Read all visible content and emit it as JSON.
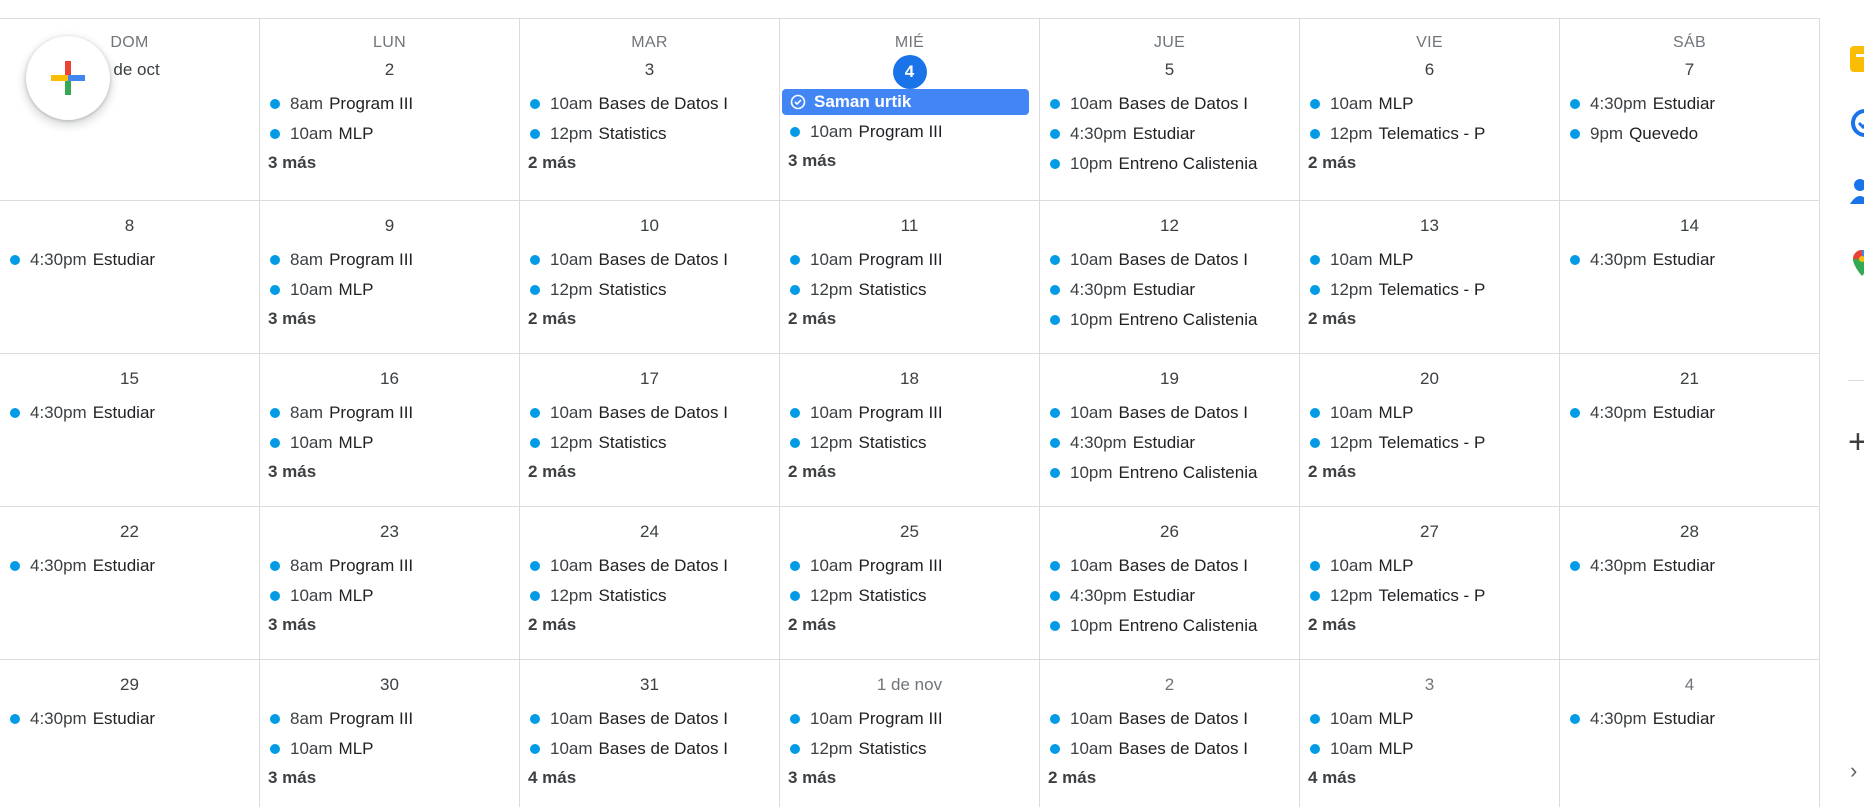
{
  "weekdays": [
    "DOM",
    "LUN",
    "MAR",
    "MIÉ",
    "JUE",
    "VIE",
    "SÁB"
  ],
  "weeks": [
    [
      {
        "day": "1 de oct",
        "events": [],
        "more": ""
      },
      {
        "day": "2",
        "events": [
          {
            "time": "8am",
            "title": "Program III"
          },
          {
            "time": "10am",
            "title": "MLP"
          }
        ],
        "more": "3 más"
      },
      {
        "day": "3",
        "events": [
          {
            "time": "10am",
            "title": "Bases de Datos I"
          },
          {
            "time": "12pm",
            "title": "Statistics"
          }
        ],
        "more": "2 más"
      },
      {
        "day": "4",
        "today": true,
        "chip": "Saman urtik",
        "events": [
          {
            "time": "10am",
            "title": "Program III"
          }
        ],
        "more": "3 más"
      },
      {
        "day": "5",
        "events": [
          {
            "time": "10am",
            "title": "Bases de Datos I"
          },
          {
            "time": "4:30pm",
            "title": "Estudiar"
          },
          {
            "time": "10pm",
            "title": "Entreno Calistenia"
          }
        ],
        "more": ""
      },
      {
        "day": "6",
        "events": [
          {
            "time": "10am",
            "title": "MLP"
          },
          {
            "time": "12pm",
            "title": "Telematics - P"
          }
        ],
        "more": "2 más"
      },
      {
        "day": "7",
        "events": [
          {
            "time": "4:30pm",
            "title": "Estudiar"
          },
          {
            "time": "9pm",
            "title": "Quevedo"
          }
        ],
        "more": ""
      }
    ],
    [
      {
        "day": "8",
        "events": [
          {
            "time": "4:30pm",
            "title": "Estudiar"
          }
        ],
        "more": ""
      },
      {
        "day": "9",
        "events": [
          {
            "time": "8am",
            "title": "Program III"
          },
          {
            "time": "10am",
            "title": "MLP"
          }
        ],
        "more": "3 más"
      },
      {
        "day": "10",
        "events": [
          {
            "time": "10am",
            "title": "Bases de Datos I"
          },
          {
            "time": "12pm",
            "title": "Statistics"
          }
        ],
        "more": "2 más"
      },
      {
        "day": "11",
        "events": [
          {
            "time": "10am",
            "title": "Program III"
          },
          {
            "time": "12pm",
            "title": "Statistics"
          }
        ],
        "more": "2 más"
      },
      {
        "day": "12",
        "events": [
          {
            "time": "10am",
            "title": "Bases de Datos I"
          },
          {
            "time": "4:30pm",
            "title": "Estudiar"
          },
          {
            "time": "10pm",
            "title": "Entreno Calistenia"
          }
        ],
        "more": ""
      },
      {
        "day": "13",
        "events": [
          {
            "time": "10am",
            "title": "MLP"
          },
          {
            "time": "12pm",
            "title": "Telematics - P"
          }
        ],
        "more": "2 más"
      },
      {
        "day": "14",
        "events": [
          {
            "time": "4:30pm",
            "title": "Estudiar"
          }
        ],
        "more": ""
      }
    ],
    [
      {
        "day": "15",
        "events": [
          {
            "time": "4:30pm",
            "title": "Estudiar"
          }
        ],
        "more": ""
      },
      {
        "day": "16",
        "events": [
          {
            "time": "8am",
            "title": "Program III"
          },
          {
            "time": "10am",
            "title": "MLP"
          }
        ],
        "more": "3 más"
      },
      {
        "day": "17",
        "events": [
          {
            "time": "10am",
            "title": "Bases de Datos I"
          },
          {
            "time": "12pm",
            "title": "Statistics"
          }
        ],
        "more": "2 más"
      },
      {
        "day": "18",
        "events": [
          {
            "time": "10am",
            "title": "Program III"
          },
          {
            "time": "12pm",
            "title": "Statistics"
          }
        ],
        "more": "2 más"
      },
      {
        "day": "19",
        "events": [
          {
            "time": "10am",
            "title": "Bases de Datos I"
          },
          {
            "time": "4:30pm",
            "title": "Estudiar"
          },
          {
            "time": "10pm",
            "title": "Entreno Calistenia"
          }
        ],
        "more": ""
      },
      {
        "day": "20",
        "events": [
          {
            "time": "10am",
            "title": "MLP"
          },
          {
            "time": "12pm",
            "title": "Telematics - P"
          }
        ],
        "more": "2 más"
      },
      {
        "day": "21",
        "events": [
          {
            "time": "4:30pm",
            "title": "Estudiar"
          }
        ],
        "more": ""
      }
    ],
    [
      {
        "day": "22",
        "events": [
          {
            "time": "4:30pm",
            "title": "Estudiar"
          }
        ],
        "more": ""
      },
      {
        "day": "23",
        "events": [
          {
            "time": "8am",
            "title": "Program III"
          },
          {
            "time": "10am",
            "title": "MLP"
          }
        ],
        "more": "3 más"
      },
      {
        "day": "24",
        "events": [
          {
            "time": "10am",
            "title": "Bases de Datos I"
          },
          {
            "time": "12pm",
            "title": "Statistics"
          }
        ],
        "more": "2 más"
      },
      {
        "day": "25",
        "events": [
          {
            "time": "10am",
            "title": "Program III"
          },
          {
            "time": "12pm",
            "title": "Statistics"
          }
        ],
        "more": "2 más"
      },
      {
        "day": "26",
        "events": [
          {
            "time": "10am",
            "title": "Bases de Datos I"
          },
          {
            "time": "4:30pm",
            "title": "Estudiar"
          },
          {
            "time": "10pm",
            "title": "Entreno Calistenia"
          }
        ],
        "more": ""
      },
      {
        "day": "27",
        "events": [
          {
            "time": "10am",
            "title": "MLP"
          },
          {
            "time": "12pm",
            "title": "Telematics - P"
          }
        ],
        "more": "2 más"
      },
      {
        "day": "28",
        "events": [
          {
            "time": "4:30pm",
            "title": "Estudiar"
          }
        ],
        "more": ""
      }
    ],
    [
      {
        "day": "29",
        "events": [
          {
            "time": "4:30pm",
            "title": "Estudiar"
          }
        ],
        "more": ""
      },
      {
        "day": "30",
        "events": [
          {
            "time": "8am",
            "title": "Program III"
          },
          {
            "time": "10am",
            "title": "MLP"
          }
        ],
        "more": "3 más"
      },
      {
        "day": "31",
        "events": [
          {
            "time": "10am",
            "title": "Bases de Datos I"
          },
          {
            "time": "10am",
            "title": "Bases de Datos I"
          }
        ],
        "more": "4 más"
      },
      {
        "day": "1 de nov",
        "other": true,
        "events": [
          {
            "time": "10am",
            "title": "Program III"
          },
          {
            "time": "12pm",
            "title": "Statistics"
          }
        ],
        "more": "3 más"
      },
      {
        "day": "2",
        "other": true,
        "events": [
          {
            "time": "10am",
            "title": "Bases de Datos I"
          },
          {
            "time": "10am",
            "title": "Bases de Datos I"
          }
        ],
        "more": "2 más"
      },
      {
        "day": "3",
        "other": true,
        "events": [
          {
            "time": "10am",
            "title": "MLP"
          },
          {
            "time": "10am",
            "title": "MLP"
          }
        ],
        "more": "4 más"
      },
      {
        "day": "4",
        "other": true,
        "events": [
          {
            "time": "4:30pm",
            "title": "Estudiar"
          }
        ],
        "more": ""
      }
    ]
  ],
  "colors": {
    "event_dot": "#039be5",
    "today": "#1a73e8",
    "chip": "#4285f4"
  },
  "icons": {
    "fab": "create-plus-icon",
    "chip": "task-check-icon"
  }
}
